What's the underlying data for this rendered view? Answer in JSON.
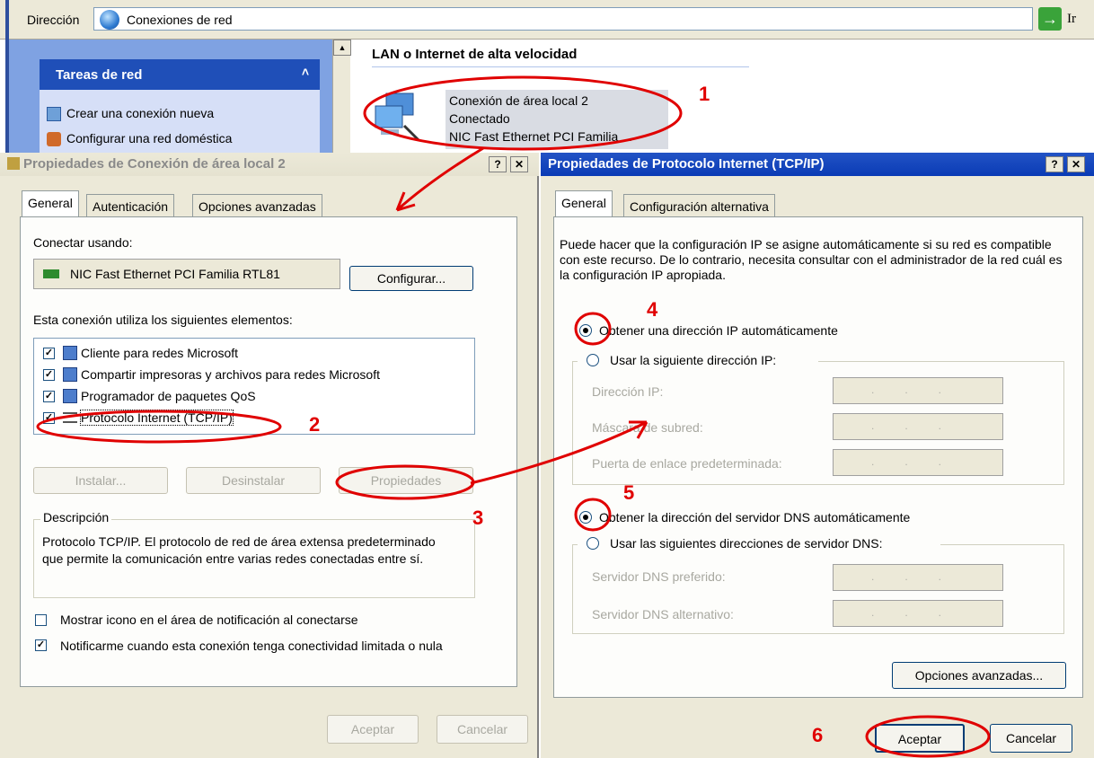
{
  "addressbar": {
    "label": "Dirección",
    "value": "Conexiones de red",
    "go_label": "Ir",
    "go_glyph": "→",
    "dropdown_glyph": "▼"
  },
  "tasks": {
    "title": "Tareas de red",
    "collapse_glyph": "˄",
    "items": [
      {
        "label": "Crear una conexión nueva",
        "icon": "new-connection-icon"
      },
      {
        "label": "Configurar una red doméstica",
        "icon": "home-network-icon"
      }
    ]
  },
  "scrollbar": {
    "up_glyph": "▲"
  },
  "connections": {
    "section_header": "LAN o Internet de alta velocidad",
    "item": {
      "name": "Conexión de área local 2",
      "status": "Conectado",
      "device": "NIC Fast Ethernet PCI Familia ..."
    }
  },
  "dialog_left": {
    "title": "Propiedades de Conexión de área local 2",
    "help_glyph": "?",
    "close_glyph": "✕",
    "tabs": [
      "General",
      "Autenticación",
      "Opciones avanzadas"
    ],
    "connect_using_label": "Conectar usando:",
    "adapter_name": "NIC Fast Ethernet PCI Familia RTL81",
    "configure_button": "Configurar...",
    "elements_label": "Esta conexión utiliza los siguientes elementos:",
    "components": [
      {
        "label": "Cliente para redes Microsoft",
        "checked": true
      },
      {
        "label": "Compartir impresoras y archivos para redes Microsoft",
        "checked": true
      },
      {
        "label": "Programador de paquetes QoS",
        "checked": true
      },
      {
        "label": "Protocolo Internet (TCP/IP)",
        "checked": true
      }
    ],
    "install_button": "Instalar...",
    "uninstall_button": "Desinstalar",
    "properties_button": "Propiedades",
    "description_legend": "Descripción",
    "description_text": "Protocolo TCP/IP. El protocolo de red de área extensa predeterminado que permite la comunicación entre varias redes conectadas entre sí.",
    "show_icon_label": "Mostrar icono en el área de notificación al conectarse",
    "show_icon_checked": false,
    "notify_label": "Notificarme cuando esta conexión tenga conectividad limitada o nula",
    "notify_checked": true,
    "ok_button": "Aceptar",
    "cancel_button": "Cancelar",
    "check_glyph": "✓"
  },
  "dialog_right": {
    "title": "Propiedades de Protocolo Internet (TCP/IP)",
    "help_glyph": "?",
    "close_glyph": "✕",
    "tabs": [
      "General",
      "Configuración alternativa"
    ],
    "intro": "Puede hacer que la configuración IP se asigne automáticamente si su red es compatible con este recurso. De lo contrario, necesita consultar con el administrador de la red cuál es la configuración IP apropiada.",
    "ip_auto_label": "Obtener una dirección IP automáticamente",
    "ip_auto_selected": true,
    "ip_manual_label": "Usar la siguiente dirección IP:",
    "ip_address_label": "Dirección IP:",
    "subnet_label": "Máscara de subred:",
    "gateway_label": "Puerta de enlace predeterminada:",
    "dns_auto_label": "Obtener la dirección del servidor DNS automáticamente",
    "dns_auto_selected": true,
    "dns_manual_label": "Usar las siguientes direcciones de servidor DNS:",
    "dns_pref_label": "Servidor DNS preferido:",
    "dns_alt_label": "Servidor DNS alternativo:",
    "ip_placeholder": "...",
    "advanced_button": "Opciones avanzadas...",
    "ok_button": "Aceptar",
    "cancel_button": "Cancelar"
  },
  "annotations": {
    "n1": "1",
    "n2": "2",
    "n3": "3",
    "n4": "4",
    "n5": "5",
    "n6": "6",
    "color": "#e00000"
  }
}
